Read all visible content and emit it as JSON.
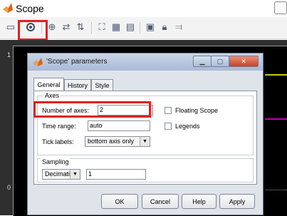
{
  "scope_window": {
    "title": "Scope",
    "toolbar_buttons": [
      "print-icon",
      "parameters-icon",
      "zoom-icon",
      "zoom-x-icon",
      "zoom-y-icon",
      "autoscale-icon",
      "save-axes-icon",
      "restore-axes-icon",
      "floating-scope-icon",
      "lock-icon",
      "signal-selection-icon"
    ],
    "axis_labels": {
      "y_top": "1",
      "y_bottom": "0"
    }
  },
  "dialog": {
    "title": "'Scope' parameters",
    "tabs": [
      "General",
      "History",
      "Style"
    ],
    "axes_group_label": "Axes",
    "number_of_axes_label": "Number of axes:",
    "number_of_axes_value": "2",
    "time_range_label": "Time range:",
    "time_range_value": "auto",
    "tick_labels_label": "Tick labels:",
    "tick_labels_value": "bottom axis only",
    "floating_scope_label": "Floating Scope",
    "legends_label": "Legends",
    "sampling_group_label": "Sampling",
    "sampling_mode_value": "Decimation",
    "sampling_factor_value": "1",
    "buttons": {
      "ok": "OK",
      "cancel": "Cancel",
      "help": "Help",
      "apply": "Apply"
    }
  },
  "colors": {
    "highlight": "#e0201a",
    "plot_background": "#000000",
    "signal_yellow": "#c8c800",
    "signal_magenta": "#c000c0"
  }
}
